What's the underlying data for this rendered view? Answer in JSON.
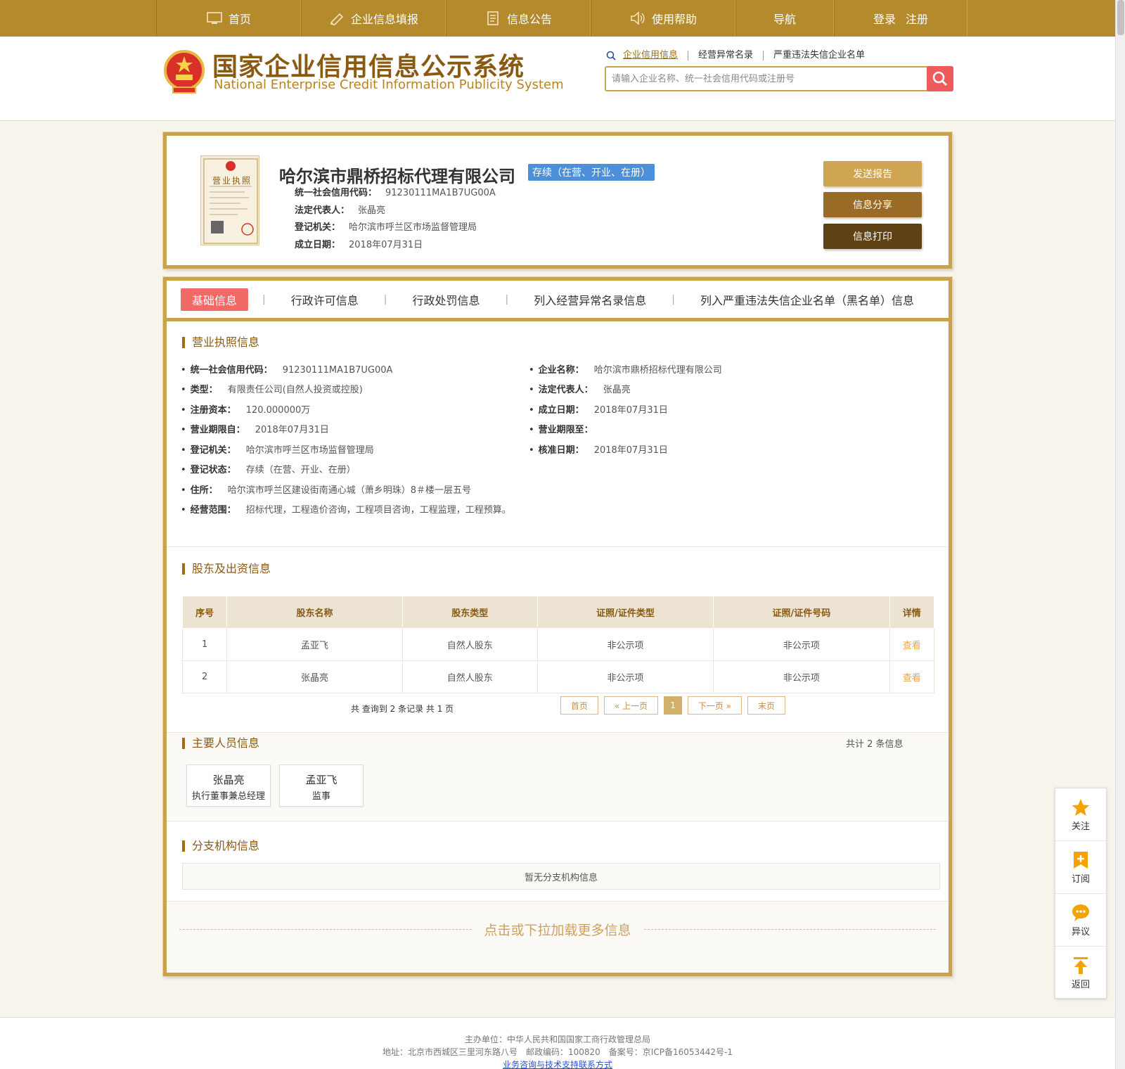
{
  "nav": {
    "home": "首页",
    "report": "企业信息填报",
    "notice": "信息公告",
    "help": "使用帮助",
    "guide": "导航",
    "login": "登录",
    "register": "注册"
  },
  "header": {
    "title_cn": "国家企业信用信息公示系统",
    "title_en": "National Enterprise Credit Information Publicity System",
    "search_links": [
      "企业信用信息",
      "经营异常名录",
      "严重违法失信企业名单"
    ],
    "search_placeholder": "请输入企业名称、统一社会信用代码或注册号"
  },
  "company": {
    "name": "哈尔滨市鼎桥招标代理有限公司",
    "status": "存续（在营、开业、在册）",
    "credit_code_label": "统一社会信用代码：",
    "credit_code": "91230111MA1B7UG00A",
    "legal_rep_label": "法定代表人：",
    "legal_rep": "张晶亮",
    "reg_authority_label": "登记机关：",
    "reg_authority": "哈尔滨市呼兰区市场监督管理局",
    "est_date_label": "成立日期：",
    "est_date": "2018年07月31日",
    "license_text": "营业执照",
    "buttons": {
      "send_report": "发送报告",
      "share": "信息分享",
      "print": "信息打印"
    }
  },
  "tabs": [
    "基础信息",
    "行政许可信息",
    "行政处罚信息",
    "列入经营异常名录信息",
    "列入严重违法失信企业名单（黑名单）信息"
  ],
  "license_section": {
    "title": "营业执照信息",
    "left": [
      {
        "label": "统一社会信用代码：",
        "value": "91230111MA1B7UG00A"
      },
      {
        "label": "类型：",
        "value": "有限责任公司(自然人投资或控股)"
      },
      {
        "label": "注册资本：",
        "value": "120.000000万"
      },
      {
        "label": "营业期限自：",
        "value": "2018年07月31日"
      },
      {
        "label": "登记机关：",
        "value": "哈尔滨市呼兰区市场监督管理局"
      },
      {
        "label": "登记状态：",
        "value": "存续（在营、开业、在册）"
      },
      {
        "label": "住所：",
        "value": "哈尔滨市呼兰区建设街南通心城（萧乡明珠）8＃楼一层五号"
      },
      {
        "label": "经营范围：",
        "value": "招标代理，工程造价咨询，工程项目咨询，工程监理，工程预算。"
      }
    ],
    "right": [
      {
        "label": "企业名称：",
        "value": "哈尔滨市鼎桥招标代理有限公司"
      },
      {
        "label": "法定代表人：",
        "value": "张晶亮"
      },
      {
        "label": "成立日期：",
        "value": "2018年07月31日"
      },
      {
        "label": "营业期限至：",
        "value": ""
      },
      {
        "label": "核准日期：",
        "value": "2018年07月31日"
      }
    ]
  },
  "shareholders": {
    "title": "股东及出资信息",
    "columns": [
      "序号",
      "股东名称",
      "股东类型",
      "证照/证件类型",
      "证照/证件号码",
      "详情"
    ],
    "rows": [
      [
        "1",
        "孟亚飞",
        "自然人股东",
        "非公示项",
        "非公示项",
        "查看"
      ],
      [
        "2",
        "张晶亮",
        "自然人股东",
        "非公示项",
        "非公示项",
        "查看"
      ]
    ],
    "summary": "共 查询到 2 条记录 共 1 页",
    "pager": {
      "first": "首页",
      "prev": "« 上一页",
      "current": "1",
      "next": "下一页 »",
      "last": "末页"
    }
  },
  "personnel": {
    "title": "主要人员信息",
    "count_text": "共计 2 条信息",
    "people": [
      {
        "name": "张晶亮",
        "role": "执行董事兼总经理"
      },
      {
        "name": "孟亚飞",
        "role": "监事"
      }
    ]
  },
  "branches": {
    "title": "分支机构信息",
    "empty": "暂无分支机构信息"
  },
  "load_more": "点击或下拉加载更多信息",
  "float_bar": [
    "关注",
    "订阅",
    "异议",
    "返回"
  ],
  "footer": {
    "line1": "主办单位：中华人民共和国国家工商行政管理总局",
    "line2": "地址：北京市西城区三里河东路八号　邮政编码：100820　备案号：京ICP备16053442号-1",
    "line3": "业务咨询与技术支持联系方式"
  },
  "colors": {
    "gold": "#b48a2d",
    "border_gold": "#c9a24c",
    "active_tab": "#f26a66",
    "status_blue": "#4d90d9",
    "btn1": "#cfa552",
    "btn2": "#9a6b26",
    "btn3": "#5e4213"
  }
}
